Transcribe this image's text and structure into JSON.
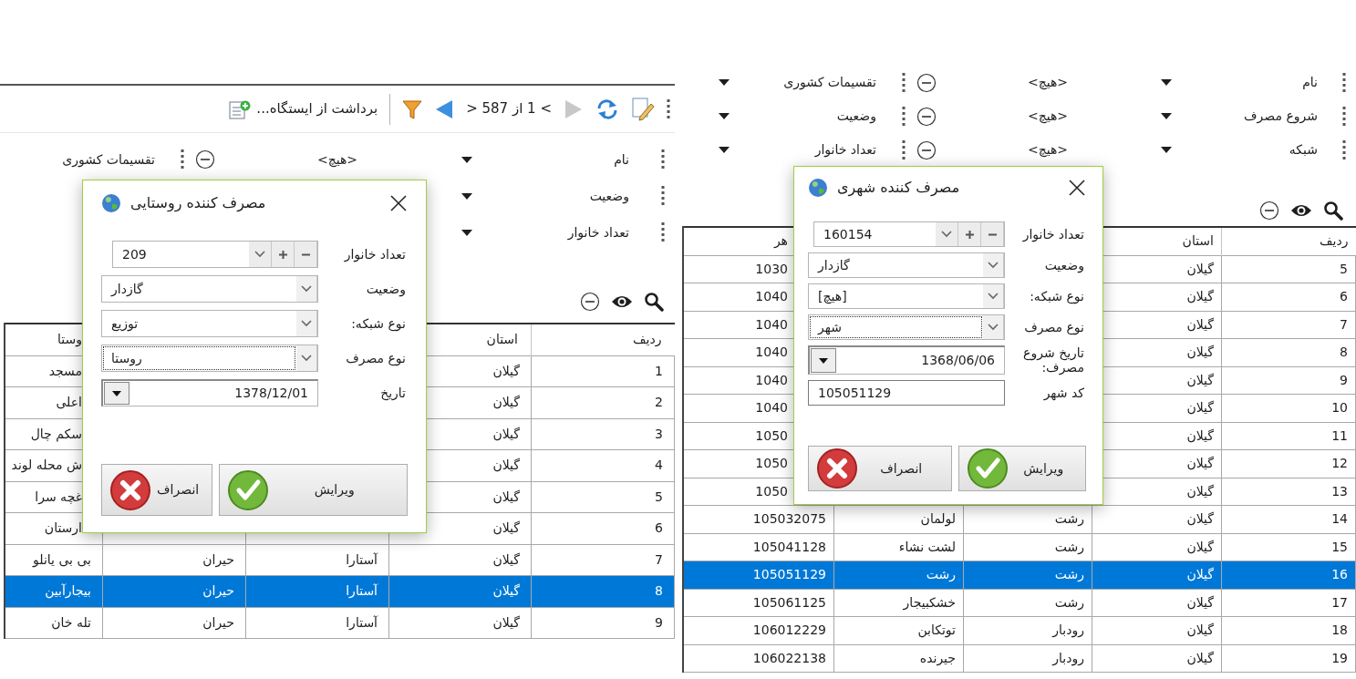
{
  "panels": [
    {
      "filters": [
        {
          "field": "نام",
          "value": "<هیچ>",
          "field_2": "تقسیمات کشوری",
          "field_2_dropdown": true
        },
        {
          "field": "شروع مصرف",
          "value": "<هیچ>",
          "field_2": "وضعیت",
          "field_2_dropdown": true
        },
        {
          "field": "شبکه",
          "value": "<هیچ>",
          "field_2": "تعداد خانوار",
          "field_2_dropdown": true
        }
      ],
      "table": {
        "columns": {
          "column_1": "ردیف",
          "column_2": "استان",
          "column_5": "هر"
        },
        "rows": [
          {
            "selected": false,
            "cells": {
              "column_1": "5",
              "column_2": "گیلان",
              "column_5": "1030"
            }
          },
          {
            "selected": false,
            "cells": {
              "column_1": "6",
              "column_2": "گیلان",
              "column_5": "1040"
            }
          },
          {
            "selected": false,
            "cells": {
              "column_1": "7",
              "column_2": "گیلان",
              "column_5": "1040"
            }
          },
          {
            "selected": false,
            "cells": {
              "column_1": "8",
              "column_2": "گیلان",
              "column_5": "1040"
            }
          },
          {
            "selected": false,
            "cells": {
              "column_1": "9",
              "column_2": "گیلان",
              "column_5": "1040"
            }
          },
          {
            "selected": false,
            "cells": {
              "column_1": "10",
              "column_2": "گیلان",
              "column_5": "1040"
            }
          },
          {
            "selected": false,
            "cells": {
              "column_1": "11",
              "column_2": "گیلان",
              "column_5": "1050"
            }
          },
          {
            "selected": false,
            "cells": {
              "column_1": "12",
              "column_2": "گیلان",
              "column_5": "1050"
            }
          },
          {
            "selected": false,
            "cells": {
              "column_1": "13",
              "column_2": "گیلان",
              "column_5": "1050"
            }
          },
          {
            "selected": false,
            "cells": {
              "column_1": "14",
              "column_2": "گیلان",
              "column_3": "رشت",
              "column_4": "لولمان",
              "column_5": "105032075"
            }
          },
          {
            "selected": false,
            "cells": {
              "column_1": "15",
              "column_2": "گیلان",
              "column_3": "رشت",
              "column_4": "لشت نشاء",
              "column_5": "105041128"
            }
          },
          {
            "selected": true,
            "cells": {
              "column_1": "16",
              "column_2": "گیلان",
              "column_3": "رشت",
              "column_4": "رشت",
              "column_5": "105051129"
            }
          },
          {
            "selected": false,
            "cells": {
              "column_1": "17",
              "column_2": "گیلان",
              "column_3": "رشت",
              "column_4": "خشکبیجار",
              "column_5": "105061125"
            }
          },
          {
            "selected": false,
            "cells": {
              "column_1": "18",
              "column_2": "گیلان",
              "column_3": "رودبار",
              "column_4": "توتکابن",
              "column_5": "106012229"
            }
          },
          {
            "selected": false,
            "cells": {
              "column_1": "19",
              "column_2": "گیلان",
              "column_3": "رودبار",
              "column_4": "جیرنده",
              "column_5": "106022138"
            }
          }
        ]
      },
      "dialog": {
        "title": "مصرف کننده شهری",
        "fields": [
          {
            "label": "تعداد خانوار",
            "kind": "spin",
            "value": "160154",
            "focused": false
          },
          {
            "label": "وضعیت",
            "kind": "combo",
            "value": "گازدار",
            "focused": false
          },
          {
            "label": "نوع شبکه:",
            "kind": "combo",
            "value": "[هیچ]",
            "focused": false
          },
          {
            "label": "نوع مصرف",
            "kind": "combo",
            "value": "شهر",
            "focused": true
          },
          {
            "label": "تاریخ شروع مصرف:",
            "kind": "date",
            "value": "1368/06/06",
            "focused": false
          },
          {
            "label": "کد شهر",
            "kind": "text",
            "value": "105051129",
            "focused": false
          }
        ],
        "buttons": [
          {
            "label": "ویرایش",
            "kind": "confirm"
          },
          {
            "label": "انصراف",
            "kind": "cancel"
          }
        ]
      }
    },
    {
      "toolbar": {
        "items": [
          {
            "kind": "edit"
          },
          {
            "kind": "refresh"
          },
          {
            "kind": "previous",
            "disabled": true
          },
          {
            "kind": "pager",
            "label": "> 1 از 587 <"
          },
          {
            "kind": "next",
            "disabled": false
          },
          {
            "kind": "filter"
          },
          {
            "kind": "separator"
          },
          {
            "kind": "action",
            "label": "برداشت از ایستگاه..."
          }
        ]
      },
      "filters": [
        {
          "field": "نام",
          "value": "<هیچ>",
          "field_2": "تقسیمات کشوری"
        },
        {
          "field": "وضعیت"
        },
        {
          "field": "تعداد خانوار"
        }
      ],
      "table": {
        "columns": {
          "column_1": "ردیف",
          "column_2": "استان",
          "column_5": "وستا"
        },
        "rows": [
          {
            "selected": false,
            "cells": {
              "column_1": "1",
              "column_2": "گیلان",
              "column_5": "مسجد"
            }
          },
          {
            "selected": false,
            "cells": {
              "column_1": "2",
              "column_2": "گیلان",
              "column_5": "اعلی"
            }
          },
          {
            "selected": false,
            "cells": {
              "column_1": "3",
              "column_2": "گیلان",
              "column_5": "سکم چال"
            }
          },
          {
            "selected": false,
            "cells": {
              "column_1": "4",
              "column_2": "گیلان",
              "column_5": "ش محله لوند"
            }
          },
          {
            "selected": false,
            "cells": {
              "column_1": "5",
              "column_2": "گیلان",
              "column_5": "غچه سرا"
            }
          },
          {
            "selected": false,
            "cells": {
              "column_1": "6",
              "column_2": "گیلان",
              "column_5": "ارستان"
            }
          },
          {
            "selected": false,
            "cells": {
              "column_1": "7",
              "column_2": "گیلان",
              "column_3": "آستارا",
              "column_4": "حیران",
              "column_5": "بی بی یانلو"
            }
          },
          {
            "selected": true,
            "cells": {
              "column_1": "8",
              "column_2": "گیلان",
              "column_3": "آستارا",
              "column_4": "حیران",
              "column_5": "بیجارآبین"
            }
          },
          {
            "selected": false,
            "cells": {
              "column_1": "9",
              "column_2": "گیلان",
              "column_3": "آستارا",
              "column_4": "حیران",
              "column_5": "تله خان"
            }
          }
        ]
      },
      "dialog": {
        "title": "مصرف کننده روستایی",
        "fields": [
          {
            "label": "تعداد خانوار",
            "kind": "spin",
            "value": "209",
            "focused": false
          },
          {
            "label": "وضعیت",
            "kind": "combo",
            "value": "گازدار",
            "focused": false
          },
          {
            "label": "نوع شبکه:",
            "kind": "combo",
            "value": "توزیع",
            "focused": false
          },
          {
            "label": "نوع مصرف",
            "kind": "combo",
            "value": "روستا",
            "focused": true
          },
          {
            "label": "تاریخ",
            "kind": "date",
            "value": "1378/12/01",
            "focused": false
          }
        ],
        "buttons": [
          {
            "label": "ویرایش",
            "kind": "confirm"
          },
          {
            "label": "انصراف",
            "kind": "cancel"
          }
        ]
      }
    }
  ]
}
